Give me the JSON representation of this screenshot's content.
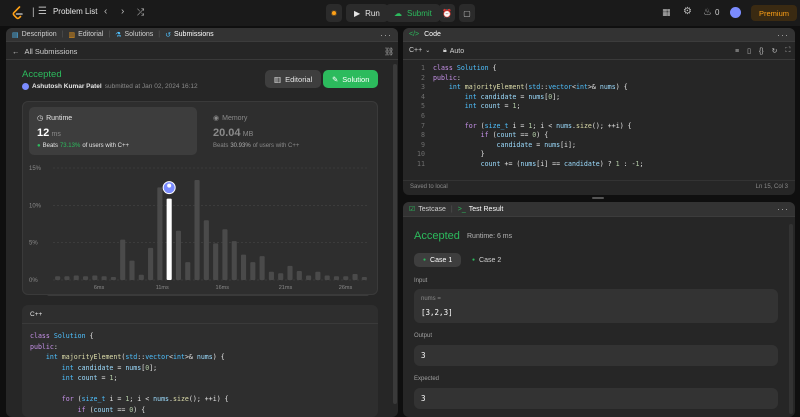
{
  "topbar": {
    "problem_list": "Problem List",
    "run": "Run",
    "submit": "Submit",
    "streak_count": "0",
    "premium": "Premium"
  },
  "left_tabs": {
    "description": "Description",
    "editorial": "Editorial",
    "solutions": "Solutions",
    "submissions": "Submissions"
  },
  "submission": {
    "back_label": "All Submissions",
    "status": "Accepted",
    "user": "Ashutosh Kumar Patel",
    "submitted_text": "submitted at Jan 02, 2024 16:12",
    "editorial_btn": "Editorial",
    "solution_btn": "Solution",
    "runtime_label": "Runtime",
    "runtime_value": "12",
    "runtime_unit": "ms",
    "runtime_beats_prefix": "Beats",
    "runtime_beats_pct": "73.13%",
    "runtime_beats_suffix": "of users with C++",
    "memory_label": "Memory",
    "memory_value": "20.04",
    "memory_unit": "MB",
    "memory_beats_prefix": "Beats",
    "memory_beats_pct": "30.93%",
    "memory_beats_suffix": "of users with C++",
    "code_lang": "C++"
  },
  "chart_data": {
    "type": "bar",
    "ylabels": [
      "15%",
      "10%",
      "5%",
      "0%"
    ],
    "xlabels": [
      "6ms",
      "11ms",
      "16ms",
      "21ms",
      "26ms"
    ],
    "mini_xlabels": [
      "6ms",
      "11ms",
      "16ms",
      "21ms",
      "26ms"
    ],
    "values": [
      0.5,
      0.5,
      0.6,
      0.5,
      0.6,
      0.5,
      0.4,
      5.4,
      2.6,
      0.7,
      4.3,
      12.4,
      10.9,
      6.6,
      2.4,
      13.4,
      8.0,
      4.9,
      6.8,
      5.2,
      3.4,
      2.4,
      3.2,
      1.1,
      0.9,
      1.9,
      1.2,
      0.6,
      1.1,
      0.6,
      0.5,
      0.5,
      0.8,
      0.4
    ],
    "highlight_index": 12,
    "ylim": [
      0,
      15
    ]
  },
  "left_code": [
    "class Solution {",
    "public:",
    "    int majorityElement(std::vector<int>& nums) {",
    "        int candidate = nums[0];",
    "        int count = 1;",
    "",
    "        for (size_t i = 1; i < nums.size(); ++i) {",
    "            if (count == 0) {"
  ],
  "code_panel": {
    "title": "Code",
    "lang": "C++",
    "auto": "Auto",
    "saved": "Saved to local",
    "position": "Ln 15, Col 3",
    "lines": [
      "class Solution {",
      "public:",
      "    int majorityElement(std::vector<int>& nums) {",
      "        int candidate = nums[0];",
      "        int count = 1;",
      "",
      "        for (size_t i = 1; i < nums.size(); ++i) {",
      "            if (count == 0) {",
      "                candidate = nums[i];",
      "            }",
      "            count += (nums[i] == candidate) ? 1 : -1;"
    ],
    "line_numbers": [
      "1",
      "2",
      "3",
      "4",
      "5",
      "6",
      "7",
      "8",
      "9",
      "10",
      "11"
    ]
  },
  "result_panel": {
    "testcase_tab": "Testcase",
    "result_tab": "Test Result",
    "status": "Accepted",
    "runtime": "Runtime: 6 ms",
    "case1": "Case 1",
    "case2": "Case 2",
    "input_label": "Input",
    "input_name": "nums =",
    "input_value": "[3,2,3]",
    "output_label": "Output",
    "output_value": "3",
    "expected_label": "Expected",
    "expected_value": "3"
  },
  "colors": {
    "accent_green": "#2cbb5d",
    "premium_orange": "#ffa116",
    "bar_gray": "#4a4a4a",
    "bar_highlight": "#ffffff"
  }
}
